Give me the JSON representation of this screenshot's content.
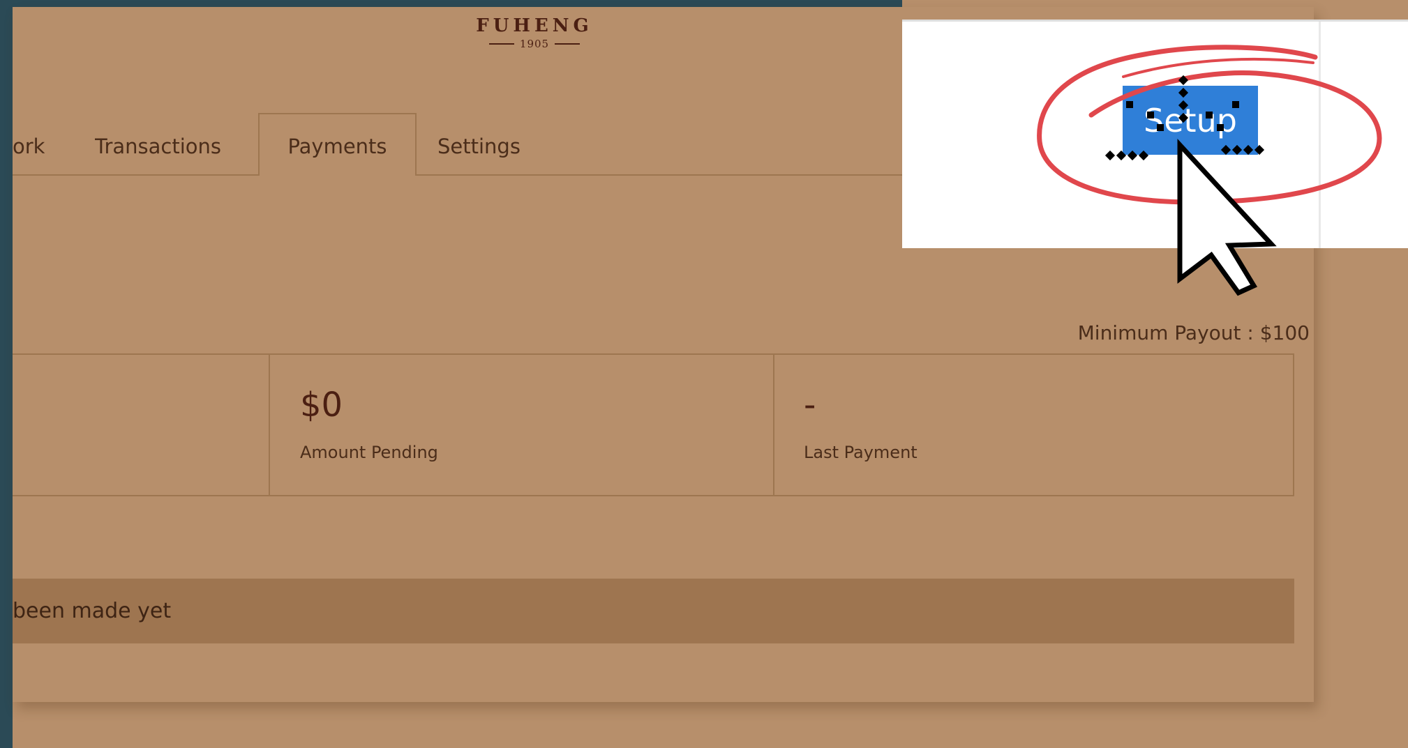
{
  "brand": {
    "name": "FUHENG",
    "year": "1905"
  },
  "tabs": [
    {
      "label": "Network",
      "visible_fragment": "ork"
    },
    {
      "label": "Transactions"
    },
    {
      "label": "Payments",
      "active": true
    },
    {
      "label": "Settings"
    }
  ],
  "payments": {
    "minimum_payout": "Minimum Payout : $100",
    "stats": [
      {
        "value": "$0",
        "label": "Amount Pending"
      },
      {
        "value": "-",
        "label": "Last Payment"
      }
    ],
    "empty_message_fragment": "been made yet"
  },
  "popup": {
    "button_label": "Setup"
  },
  "colors": {
    "page_bg": "#b78f6b",
    "border": "#9d7650",
    "banner": "#9e7550",
    "text_dark": "#4b1f12",
    "frame": "#2b4a56",
    "setup_button": "#2f7fd8",
    "annotation_circle": "#e0474c"
  },
  "icons": [
    "mouse-pointer-icon"
  ]
}
